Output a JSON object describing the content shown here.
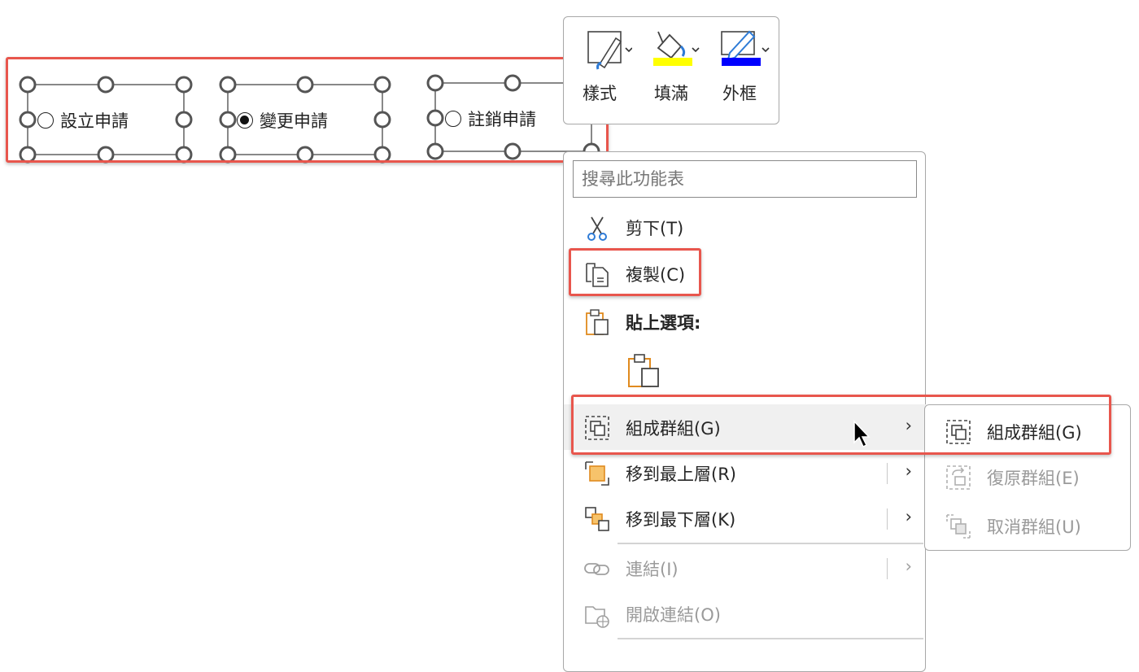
{
  "shapes": [
    {
      "label": "設立申請",
      "selected": false
    },
    {
      "label": "變更申請",
      "selected": true
    },
    {
      "label": "註銷申請",
      "selected": false
    }
  ],
  "mini_toolbar": {
    "style": {
      "label": "樣式",
      "icon": "shape-style-icon"
    },
    "fill": {
      "label": "填滿",
      "icon": "paint-bucket-icon",
      "color": "#ffff00"
    },
    "outline": {
      "label": "外框",
      "icon": "pen-outline-icon",
      "color": "#0000ff"
    }
  },
  "context_menu": {
    "search_placeholder": "搜尋此功能表",
    "items": {
      "cut": {
        "label": "剪下(T)",
        "icon": "scissors-icon"
      },
      "copy": {
        "label": "複製(C)",
        "icon": "copy-icon"
      },
      "paste_header": {
        "label": "貼上選項:",
        "icon": "clipboard-icon"
      },
      "paste_keep": {
        "icon": "clipboard-paste-icon"
      },
      "group": {
        "label": "組成群組(G)",
        "icon": "group-icon",
        "has_submenu": true
      },
      "bring_front": {
        "label": "移到最上層(R)",
        "icon": "bring-to-front-icon",
        "has_submenu": true
      },
      "send_back": {
        "label": "移到最下層(K)",
        "icon": "send-to-back-icon",
        "has_submenu": true
      },
      "link": {
        "label": "連結(I)",
        "icon": "link-icon",
        "disabled": true,
        "has_submenu": true
      },
      "open_link": {
        "label": "開啟連結(O)",
        "icon": "open-link-icon",
        "disabled": true
      }
    }
  },
  "submenu": {
    "group": {
      "label": "組成群組(G)",
      "icon": "group-icon"
    },
    "regroup": {
      "label": "復原群組(E)",
      "icon": "regroup-icon",
      "disabled": true
    },
    "ungroup": {
      "label": "取消群組(U)",
      "icon": "ungroup-icon",
      "disabled": true
    }
  },
  "colors": {
    "highlight": "#e8564d",
    "menu_border": "#a8a8a8",
    "hover_bg": "#f0f0f0",
    "icon_orange": "#e08a1e",
    "icon_blue": "#2e7bd6"
  }
}
